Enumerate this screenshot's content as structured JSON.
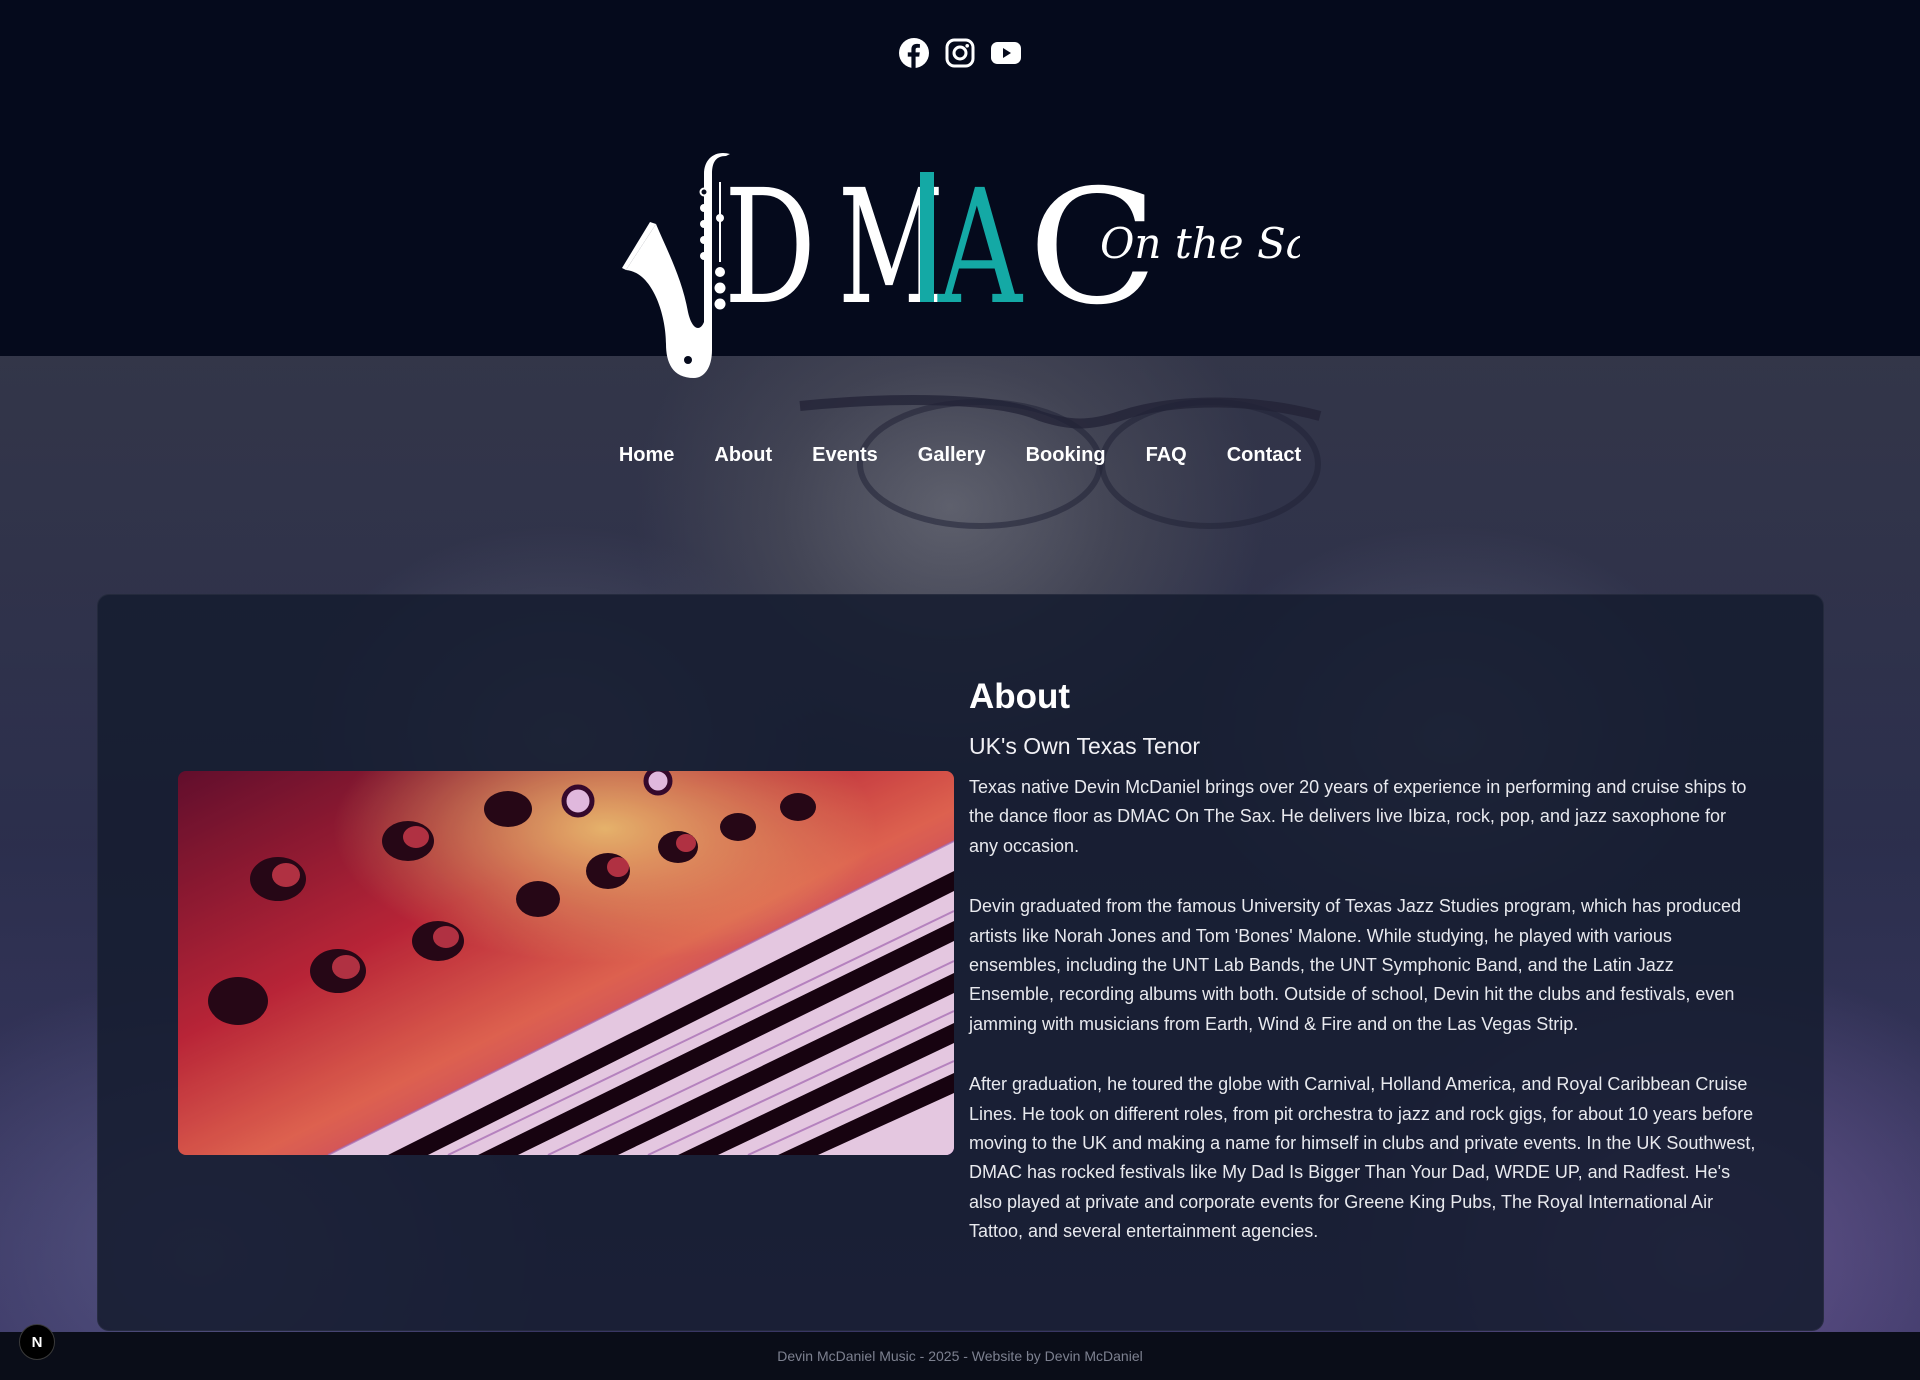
{
  "header": {
    "socials": [
      {
        "icon": "facebook-icon"
      },
      {
        "icon": "instagram-icon"
      },
      {
        "icon": "youtube-icon"
      }
    ],
    "logo": {
      "letters_white_1": "D",
      "letter_m": "M",
      "letter_a": "A",
      "letter_c": "C",
      "tagline": "On the Sax"
    }
  },
  "nav": {
    "items": [
      "Home",
      "About",
      "Events",
      "Gallery",
      "Booking",
      "FAQ",
      "Contact"
    ]
  },
  "about": {
    "title": "About",
    "subtitle": "UK's Own Texas Tenor",
    "paragraphs": [
      "Texas native Devin McDaniel brings over 20 years of experience in performing and cruise ships to the dance floor as DMAC On The Sax. He delivers live Ibiza, rock, pop, and jazz saxophone for any occasion.",
      "Devin graduated from the famous University of Texas Jazz Studies program, which has produced artists like Norah Jones and Tom 'Bones' Malone. While studying, he played with various ensembles, including the UNT Lab Bands, the UNT Symphonic Band, and the Latin Jazz Ensemble, recording albums with both. Outside of school, Devin hit the clubs and festivals, even jamming with musicians from Earth, Wind & Fire and on the Las Vegas Strip.",
      "After graduation, he toured the globe with Carnival, Holland America, and Royal Caribbean Cruise Lines. He took on different roles, from pit orchestra to jazz and rock gigs, for about 10 years before moving to the UK and making a name for himself in clubs and private events. In the UK Southwest, DMAC has rocked festivals like My Dad Is Bigger Than Your Dad, WRDE UP, and Radfest. He's also played at private and corporate events for Greene King Pubs, The Royal International Air Tattoo, and several entertainment agencies."
    ]
  },
  "footer": {
    "text": "Devin McDaniel Music - 2025 - Website by Devin McDaniel"
  },
  "dev_badge": "N",
  "colors": {
    "header_bg": "#050a1c",
    "accent_teal": "#14a9a5",
    "card_bg": "#161c30",
    "footer_bg": "#0a0d18"
  }
}
